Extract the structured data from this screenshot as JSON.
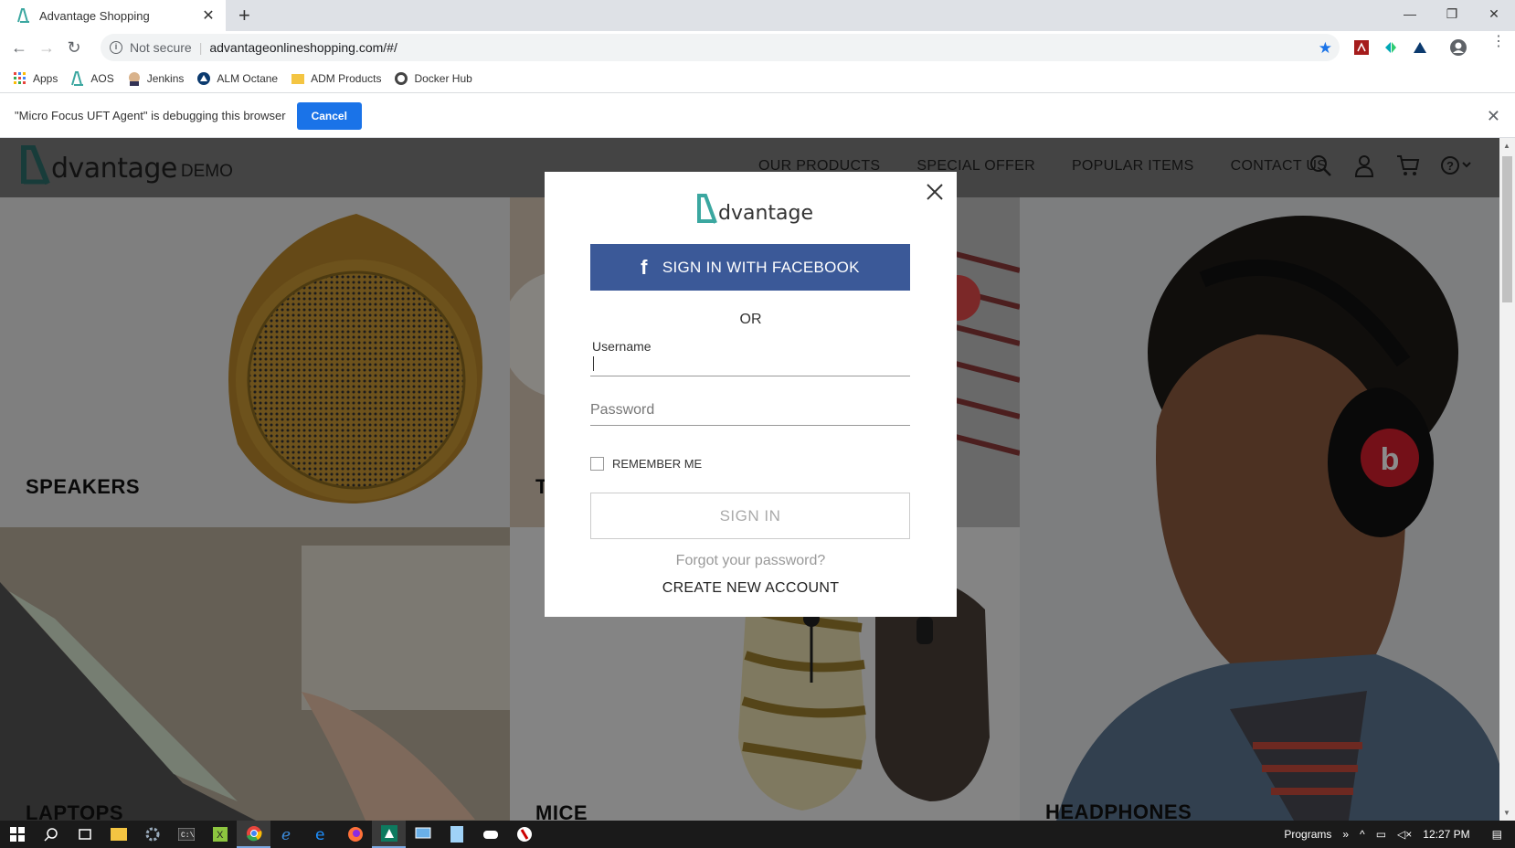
{
  "browser": {
    "tab_title": "Advantage Shopping",
    "not_secure": "Not secure",
    "url": "advantageonlineshopping.com/#/",
    "bookmarks": [
      "Apps",
      "AOS",
      "Jenkins",
      "ALM Octane",
      "ADM Products",
      "Docker Hub"
    ],
    "debug_message": "\"Micro Focus UFT Agent\" is debugging this browser",
    "debug_cancel": "Cancel"
  },
  "site": {
    "logo_text": "dvantage",
    "logo_demo": "DEMO",
    "nav": [
      "OUR PRODUCTS",
      "SPECIAL OFFER",
      "POPULAR ITEMS",
      "CONTACT US"
    ],
    "tiles": {
      "speakers": "SPEAKERS",
      "tablets": "T",
      "laptops": "LAPTOPS",
      "mice": "MICE",
      "headphones": "HEADPHONES"
    }
  },
  "modal": {
    "logo_text": "dvantage",
    "facebook_label": "SIGN IN WITH FACEBOOK",
    "facebook_icon": "f",
    "or_label": "OR",
    "username_label": "Username",
    "password_label": "Password",
    "remember_label": "REMEMBER ME",
    "signin_label": "SIGN IN",
    "forgot_label": "Forgot your password?",
    "create_label": "CREATE NEW ACCOUNT"
  },
  "taskbar": {
    "programs_label": "Programs",
    "time": "12:27 PM"
  },
  "colors": {
    "brand_teal": "#3ba7a0",
    "facebook_blue": "#3b5998",
    "chrome_blue": "#1a73e8"
  }
}
